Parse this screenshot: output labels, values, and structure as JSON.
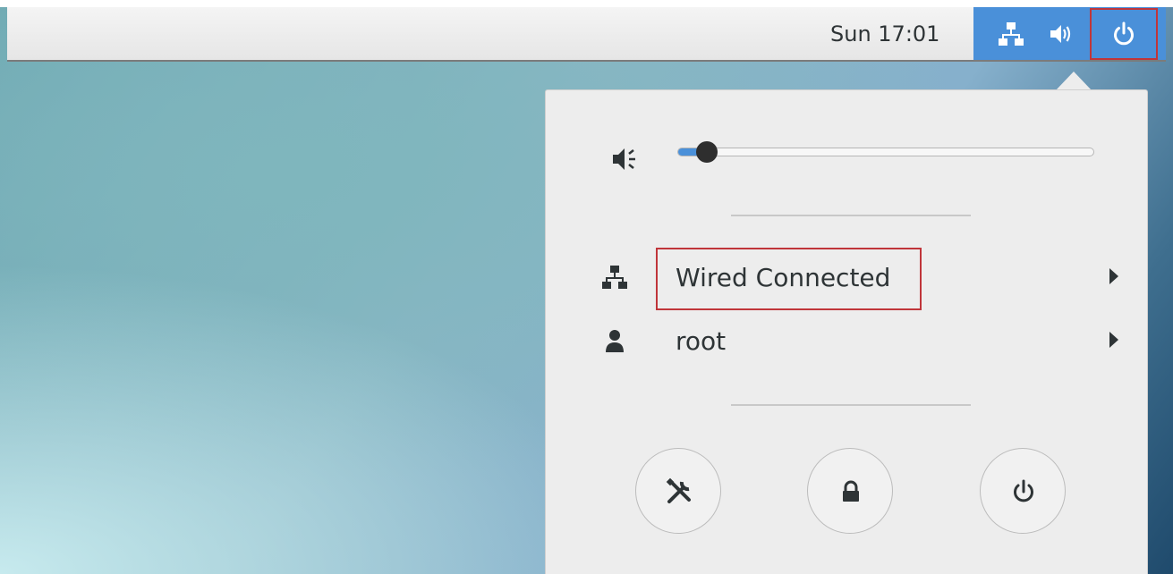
{
  "topbar": {
    "clock": "Sun 17:01",
    "status_icons": [
      "network-wired-icon",
      "volume-icon",
      "power-icon"
    ],
    "accent_color": "#4a90d9"
  },
  "menu": {
    "volume": {
      "icon": "volume-muted-icon",
      "level": 0.07
    },
    "rows": [
      {
        "icon": "network-wired-icon",
        "label": "Wired Connected"
      },
      {
        "icon": "user-icon",
        "label": "root"
      }
    ],
    "buttons": [
      "settings-icon",
      "lock-icon",
      "power-off-icon"
    ]
  },
  "highlight_color": "#c0353a"
}
